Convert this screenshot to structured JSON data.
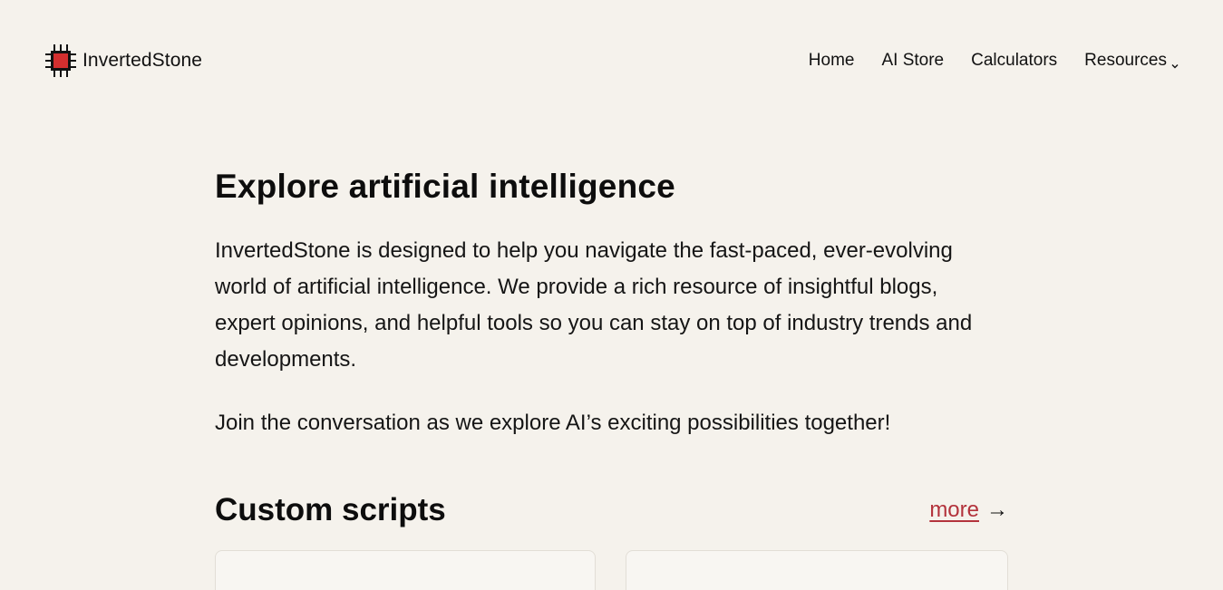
{
  "header": {
    "brand": "InvertedStone",
    "logo_icon": "chip-icon",
    "accent_color": "#d32f2f",
    "nav": [
      {
        "label": "Home"
      },
      {
        "label": "AI Store"
      },
      {
        "label": "Calculators"
      },
      {
        "label": "Resources",
        "icon": "chevron-down-icon"
      }
    ]
  },
  "main": {
    "title": "Explore artificial intelligence",
    "intro": "InvertedStone is designed to help you navigate the fast-paced, ever-evolving world of artificial intelligence. We provide a rich resource of insightful blogs, expert opinions, and helpful tools so you can stay on top of industry trends and developments.",
    "join": "Join the conversation as we explore AI’s exciting possibilities together!"
  },
  "section": {
    "title": "Custom scripts",
    "more_label": "more",
    "more_arrow": "→",
    "link_color": "#b3333c"
  }
}
